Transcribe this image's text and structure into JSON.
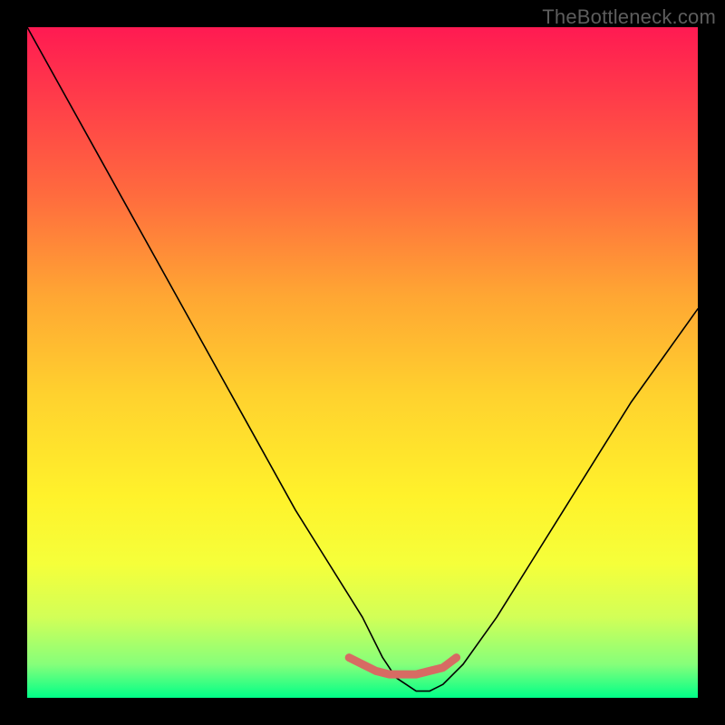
{
  "watermark": "TheBottleneck.com",
  "chart_data": {
    "type": "line",
    "title": "",
    "xlabel": "",
    "ylabel": "",
    "xlim": [
      0,
      100
    ],
    "ylim": [
      0,
      100
    ],
    "series": [
      {
        "name": "curve",
        "x": [
          0,
          5,
          10,
          15,
          20,
          25,
          30,
          35,
          40,
          45,
          50,
          53,
          55,
          58,
          60,
          62,
          65,
          70,
          75,
          80,
          85,
          90,
          95,
          100
        ],
        "values": [
          100,
          91,
          82,
          73,
          64,
          55,
          46,
          37,
          28,
          20,
          12,
          6,
          3,
          1,
          1,
          2,
          5,
          12,
          20,
          28,
          36,
          44,
          51,
          58
        ]
      },
      {
        "name": "highlight-band",
        "x": [
          48,
          50,
          52,
          54,
          56,
          58,
          60,
          62,
          64
        ],
        "values": [
          6,
          5,
          4,
          3.5,
          3.5,
          3.5,
          4,
          4.5,
          6
        ]
      }
    ],
    "colors": {
      "curve": "#000000",
      "highlight": "#d76b63",
      "gradient_top": "#ff1a52",
      "gradient_bottom": "#00ff88"
    }
  }
}
